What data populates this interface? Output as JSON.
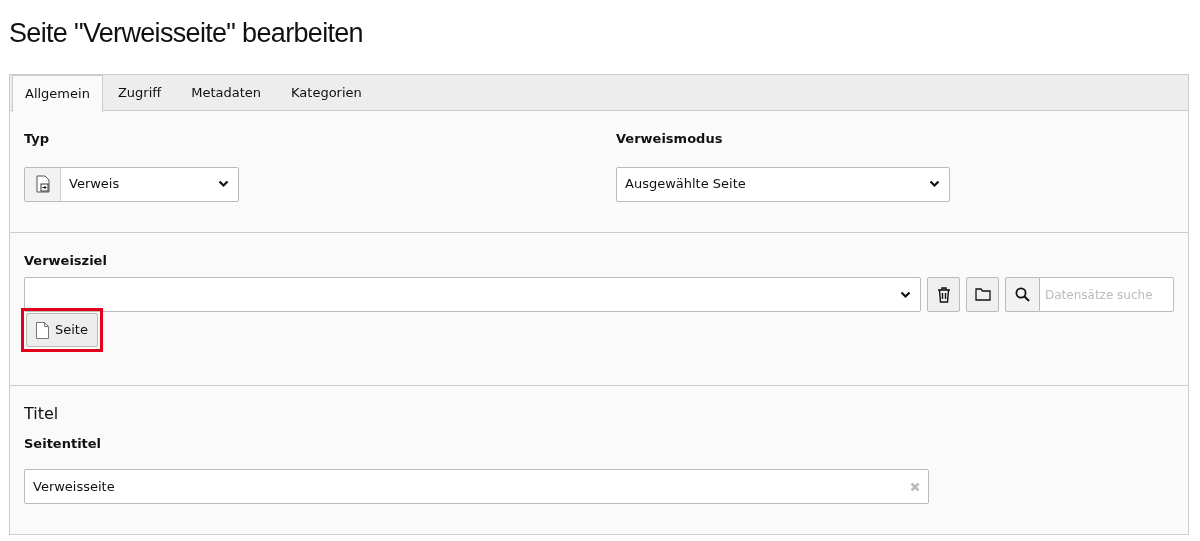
{
  "heading": "Seite \"Verweisseite\" bearbeiten",
  "tabs": [
    {
      "label": "Allgemein",
      "selected": true
    },
    {
      "label": "Zugriff",
      "selected": false
    },
    {
      "label": "Metadaten",
      "selected": false
    },
    {
      "label": "Kategorien",
      "selected": false
    }
  ],
  "typ": {
    "label": "Typ",
    "value": "Verweis"
  },
  "verweismodus": {
    "label": "Verweismodus",
    "value": "Ausgewählte Seite"
  },
  "verweisziel": {
    "label": "Verweisziel",
    "search_placeholder": "Datensätze suche",
    "page_button": {
      "label": "Seite",
      "highlighted": true
    }
  },
  "titel": {
    "section": "Titel",
    "label": "Seitentitel",
    "value": "Verweisseite"
  }
}
